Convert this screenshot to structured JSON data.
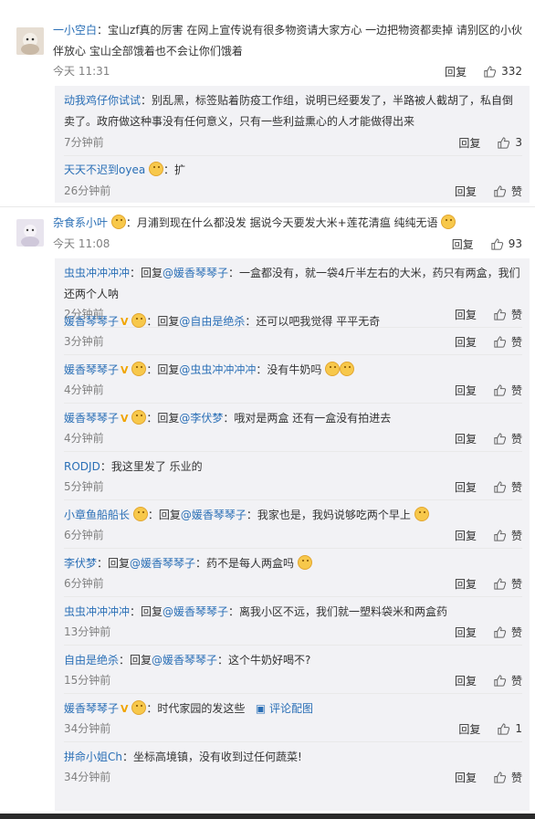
{
  "comments": [
    {
      "user": "一小空白",
      "text_line1": "：宝山zf真的厉害 在网上宣传说有很多物资请大家方心 一边把物资都卖掉 请别区的小伙",
      "text_line2": "伴放心 宝山全部饿着也不会让你们饿着",
      "time": "今天 11:31",
      "reply": "回复",
      "likes": "332",
      "replies": [
        {
          "user": "动我鸡仔你试试",
          "text1": "：别乱黑，标签贴着防疫工作组，说明已经要发了，半路被人截胡了，私自倒",
          "text2": "卖了。政府做这种事没有任何意义，只有一些利益熏心的人才能做得出来",
          "time": "7分钟前",
          "reply": "回复",
          "likes": "3"
        },
        {
          "user": "天天不迟到oyea",
          "text1": "：扩",
          "time": "26分钟前",
          "reply": "回复",
          "likes": "赞"
        }
      ]
    },
    {
      "user": "杂食系小叶",
      "text_line1": "：月浦到现在什么都没发 据说今天要发大米+莲花清瘟 纯纯无语",
      "time": "今天 11:08",
      "reply": "回复",
      "likes": "93",
      "replies": [
        {
          "user": "虫虫冲冲冲冲",
          "pre": "：回复",
          "at": "@媛香琴琴子",
          "text1": "：一盒都没有，就一袋4斤半左右的大米，药只有两盒，我们",
          "text2": "还两个人呐",
          "time": "2分钟前",
          "reply": "回复",
          "likes": "赞"
        },
        {
          "user": "媛香琴琴子",
          "pre": "：回复",
          "at": "@自由是绝杀",
          "text1": "：还可以吧我觉得 平平无奇",
          "time": "3分钟前",
          "reply": "回复",
          "likes": "赞"
        },
        {
          "user": "媛香琴琴子",
          "pre": "：回复",
          "at": "@虫虫冲冲冲冲",
          "text1": "：没有牛奶吗",
          "time": "4分钟前",
          "reply": "回复",
          "likes": "赞"
        },
        {
          "user": "媛香琴琴子",
          "pre": "：回复",
          "at": "@李伏梦",
          "text1": "：哦对是两盒 还有一盒没有拍进去",
          "time": "4分钟前",
          "reply": "回复",
          "likes": "赞"
        },
        {
          "user": "RODJD",
          "text1": "：我这里发了 乐业的",
          "time": "5分钟前",
          "reply": "回复",
          "likes": "赞"
        },
        {
          "user": "小章鱼船船长",
          "pre": "：回复",
          "at": "@媛香琴琴子",
          "text1": "：我家也是，我妈说够吃两个早上",
          "time": "6分钟前",
          "reply": "回复",
          "likes": "赞"
        },
        {
          "user": "李伏梦",
          "pre": "：回复",
          "at": "@媛香琴琴子",
          "text1": "：药不是每人两盒吗",
          "time": "6分钟前",
          "reply": "回复",
          "likes": "赞"
        },
        {
          "user": "虫虫冲冲冲冲",
          "pre": "：回复",
          "at": "@媛香琴琴子",
          "text1": "：离我小区不远，我们就一塑料袋米和两盒药",
          "time": "13分钟前",
          "reply": "回复",
          "likes": "赞"
        },
        {
          "user": "自由是绝杀",
          "pre": "：回复",
          "at": "@媛香琴琴子",
          "text1": "：这个牛奶好喝不?",
          "time": "15分钟前",
          "reply": "回复",
          "likes": "赞"
        },
        {
          "user": "媛香琴琴子",
          "text1": "：时代家园的发这些",
          "img": "评论配图",
          "time": "34分钟前",
          "reply": "回复",
          "likes": "1"
        },
        {
          "user": "拼命小姐Ch",
          "text1": "：坐标高境镇，没有收到过任何蔬菜!",
          "time": "34分钟前",
          "reply": "回复",
          "likes": "赞"
        }
      ]
    }
  ]
}
